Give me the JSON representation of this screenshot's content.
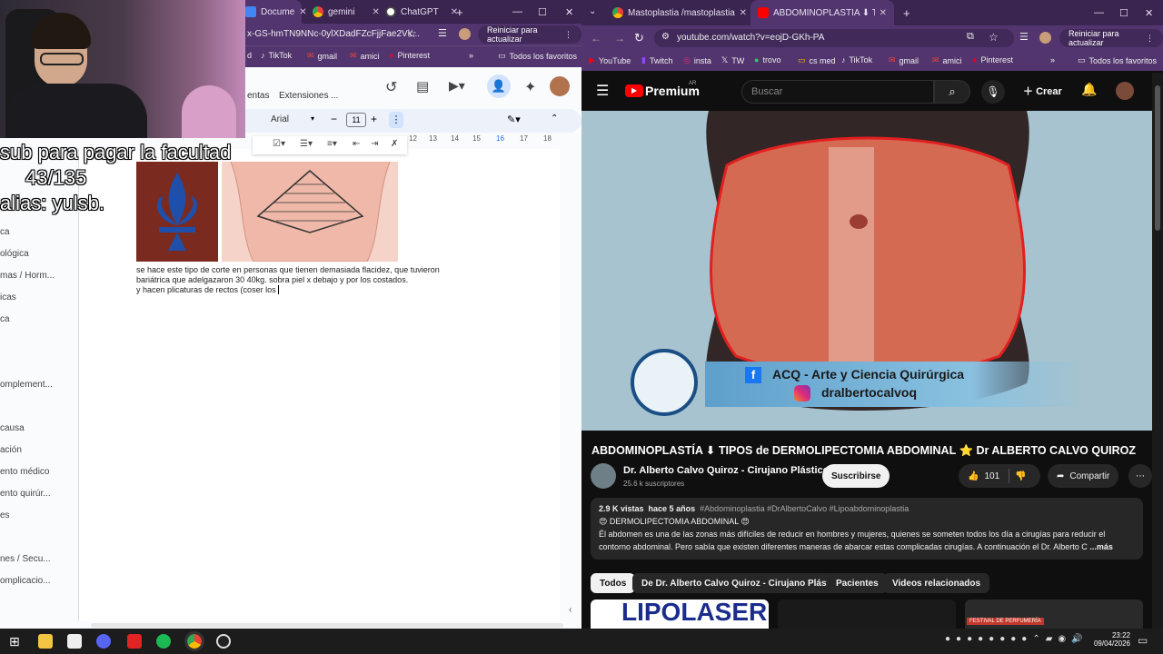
{
  "left_browser": {
    "tabs": [
      {
        "label": "Docume",
        "icon": "docs-icon",
        "color": "#4285f4"
      },
      {
        "label": "gemini",
        "icon": "chrome-icon",
        "color": "#34a853"
      },
      {
        "label": "ChatGPT",
        "icon": "chatgpt-icon",
        "color": "#ffffff"
      }
    ],
    "new_tab": "+",
    "address": "x-GS-hmTN9NNc-0ylXDadFZcFjjFae2Vk...",
    "update_button": "Reiniciar para actualizar",
    "bookmarks": [
      "d",
      "TikTok",
      "gmail",
      "amici",
      "Pinterest"
    ],
    "bookmarks_all": "Todos los favoritos"
  },
  "docs": {
    "menu_extensions": "Extensiones",
    "menu_partial": "entas",
    "menu_more": "...",
    "font_name": "Arial",
    "font_size": "11",
    "ruler_ticks": [
      "12",
      "13",
      "14",
      "15",
      "16",
      "17",
      "18"
    ],
    "outline_items": [
      "ca",
      "ológica",
      "mas / Horm...",
      "icas",
      "ca",
      "omplement...",
      "causa",
      "ación",
      "ento médico",
      "ento quirúr...",
      "es",
      "nes / Secu...",
      "omplicacio..."
    ],
    "body_lines": [
      "se hace este tipo de corte en personas que tienen demasiada flacidez, que tuvieron",
      "bariátrica que adelgazaron 30 40kg. sobra piel x debajo y por los costados.",
      "y hacen plicaturas de rectos (coser los "
    ]
  },
  "stream_overlay": {
    "line1": "sub para pagar la facultad",
    "line2": "43/135",
    "line3": "alias: yulsb."
  },
  "right_browser": {
    "tabs": [
      {
        "label": "Mastoplastia /mastoplastia de",
        "icon": "chrome-icon"
      },
      {
        "label": "ABDOMINOPLASTÍA ⬇ TIPOS d",
        "icon": "youtube-icon"
      }
    ],
    "address": "youtube.com/watch?v=eojD-GKh-PA",
    "update_button": "Reiniciar para actualizar",
    "bookmarks": [
      "YouTube",
      "Twitch",
      "insta",
      "TW",
      "trovo",
      "cs med",
      "TikTok",
      "gmail",
      "amici",
      "Pinterest"
    ],
    "bookmarks_all": "Todos los favoritos"
  },
  "youtube": {
    "logo": "Premium",
    "region": "AR",
    "search_placeholder": "Buscar",
    "create": "Crear",
    "video_overlay_line1": "ACQ - Arte y Ciencia Quirúrgica",
    "video_overlay_line2": "dralbertocalvoq",
    "title": "ABDOMINOPLASTÍA ⬇ TIPOS de DERMOLIPECTOMIA ABDOMINAL ⭐ Dr ALBERTO CALVO QUIROZ",
    "channel_name": "Dr. Alberto Calvo Quiroz - Cirujano Plástico",
    "subscribers": "25.6 k suscriptores",
    "subscribe": "Suscribirse",
    "likes": "101",
    "share": "Compartir",
    "views": "2.9 K vistas",
    "age": "hace 5 años",
    "hashtags": "#Abdominoplastia #DrAlbertoCalvo #Lipoabdominoplastia",
    "desc_heading": "😍 DERMOLIPECTOMIA ABDOMINAL 😍",
    "desc_line1": "Él abdomen es una de las zonas más difíciles de reducir en  hombres y mujeres, quienes se someten todos los día a cirugías para reducir el",
    "desc_line2": "contorno abdominal. Pero sabía que existen diferentes maneras de abarcar estas complicadas cirugías. A continuación el Dr. Alberto C",
    "more": "...más",
    "chips": [
      "Todos",
      "De Dr. Alberto Calvo Quiroz - Cirujano Plástico",
      "Pacientes",
      "Videos relacionados"
    ],
    "thumb1_text": "LIPOLASER",
    "thumb3_text": "FESTIVAL DE PERFUMERÍA"
  },
  "taskbar": {
    "time": "23:22",
    "date": "09/04/2026"
  }
}
